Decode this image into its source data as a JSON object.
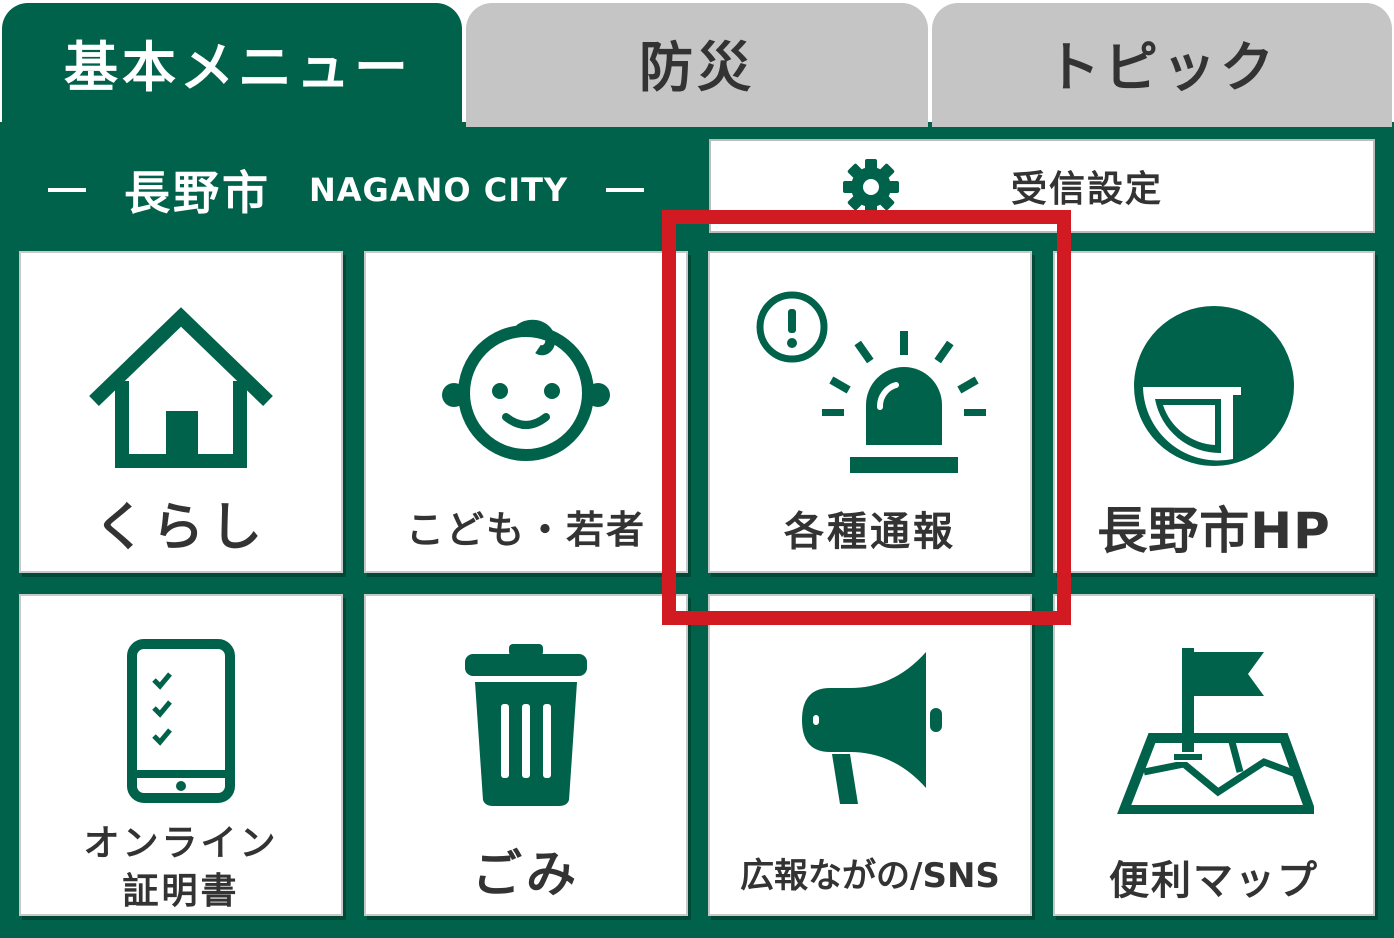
{
  "tabs": [
    {
      "label": "基本メニュー",
      "active": true
    },
    {
      "label": "防災",
      "active": false
    },
    {
      "label": "トピック",
      "active": false
    }
  ],
  "city": {
    "name_jp": "長野市",
    "name_en": "NAGANO CITY"
  },
  "settings": {
    "label": "受信設定",
    "icon": "gear-icon"
  },
  "menu": [
    {
      "label": "くらし",
      "icon": "house-icon"
    },
    {
      "label": "こども・若者",
      "icon": "baby-face-icon"
    },
    {
      "label": "各種通報",
      "icon": "alarm-light-icon",
      "highlighted": true
    },
    {
      "label": "長野市HP",
      "icon": "city-logo-icon"
    },
    {
      "label_line1": "オンライン",
      "label_line2": "証明書",
      "icon": "smartphone-checklist-icon"
    },
    {
      "label": "ごみ",
      "icon": "trash-can-icon"
    },
    {
      "label": "広報ながの/SNS",
      "icon": "megaphone-icon"
    },
    {
      "label": "便利マップ",
      "icon": "map-flag-icon"
    }
  ],
  "colors": {
    "brand_green": "#00624a",
    "tab_inactive": "#c5c5c5",
    "highlight_red": "#d21a22"
  }
}
